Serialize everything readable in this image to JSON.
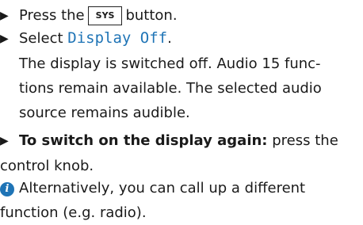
{
  "steps": [
    {
      "before": "Press the",
      "key": "SYS",
      "after": "button."
    },
    {
      "before": "Select",
      "code": "Display Off",
      "after": ".",
      "description": [
        "The display is switched off. Audio 15 func-",
        "tions remain available. The selected audio",
        "source remains audible."
      ]
    },
    {
      "bold": "To switch on the display again:",
      "after": "press the",
      "continuation": "control knob."
    }
  ],
  "info": {
    "icon": "info-icon",
    "lines": [
      "Alternatively, you can call up a different",
      "function (e.g. radio)."
    ]
  },
  "colors": {
    "accent": "#1f74b6",
    "text": "#1a1a1a"
  }
}
